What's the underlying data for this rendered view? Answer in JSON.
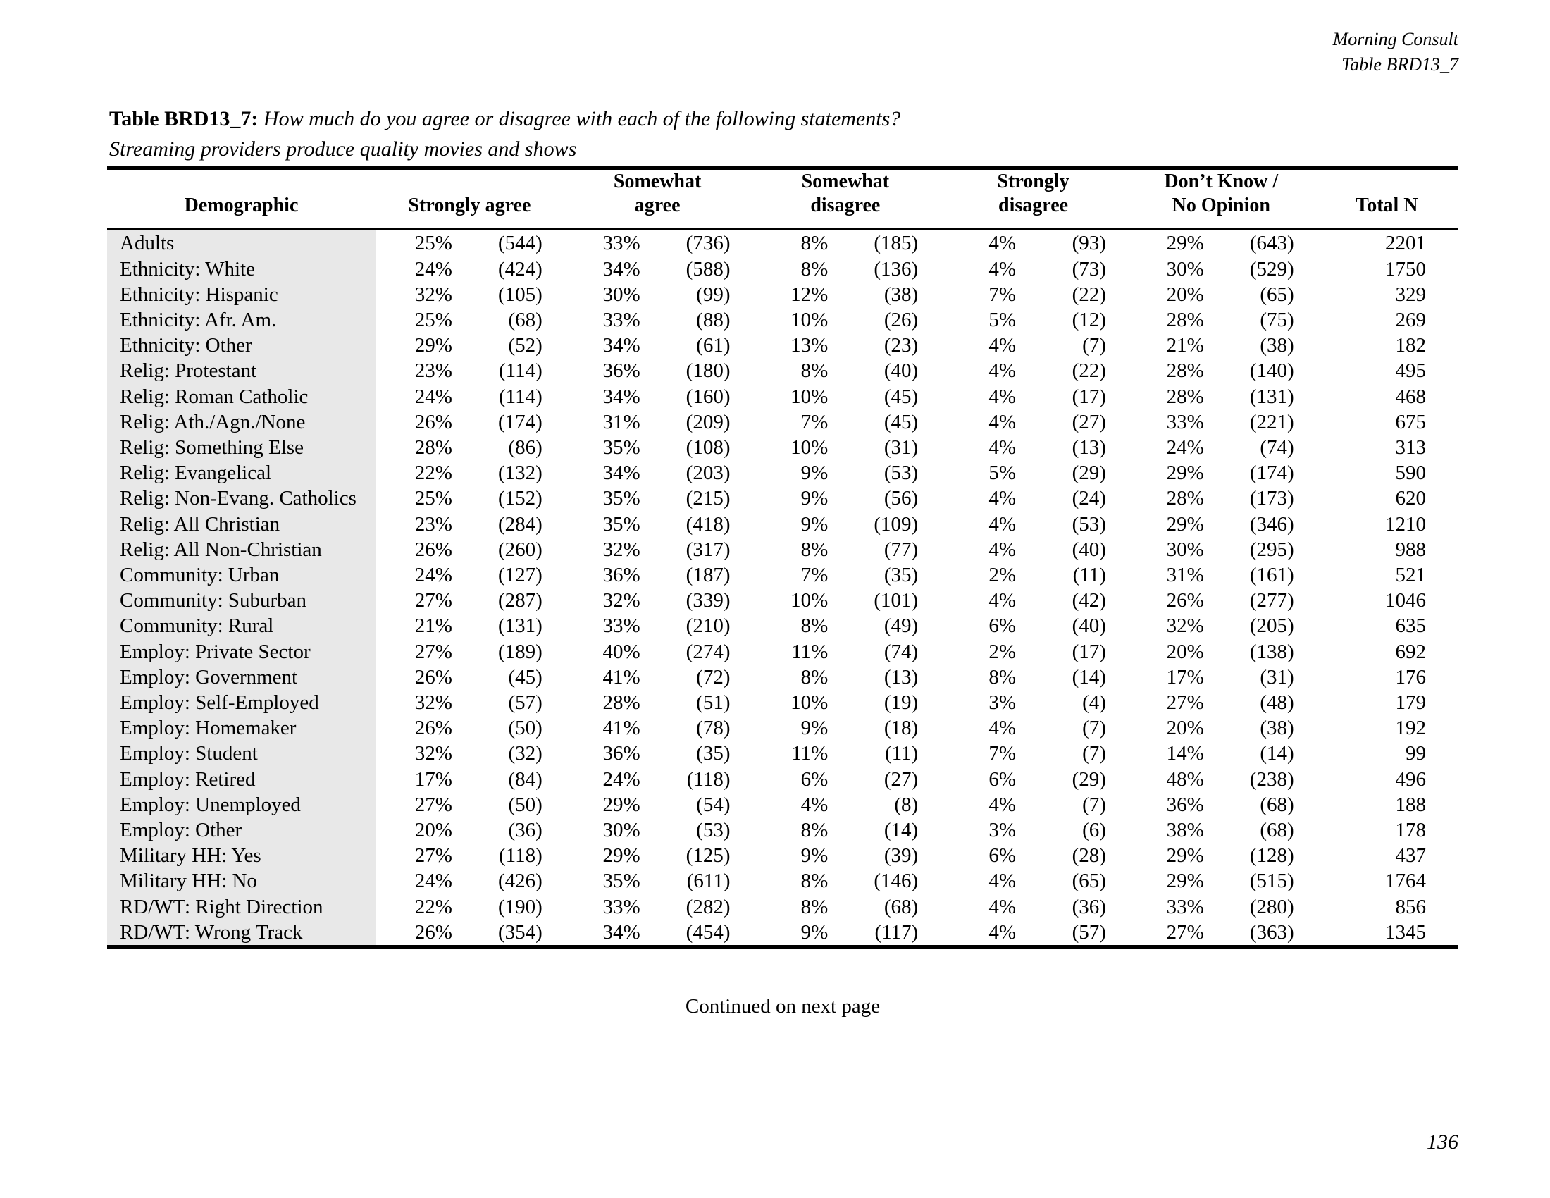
{
  "running_header": {
    "publisher": "Morning Consult",
    "table_ref": "Table BRD13_7"
  },
  "caption": {
    "label": "Table BRD13_7:",
    "question": " How much do you agree or disagree with each of the following statements?",
    "statement": "Streaming providers produce quality movies and shows"
  },
  "footer": {
    "continued": "Continued on next page",
    "page_number": "136"
  },
  "colors": {
    "row_label_shading": "#e8e8e8",
    "rule": "#000000",
    "text": "#000000"
  },
  "table": {
    "headers": {
      "demographic": "Demographic",
      "strongly_agree": "Strongly agree",
      "somewhat_agree_l1": "Somewhat",
      "somewhat_agree_l2": "agree",
      "somewhat_disagree_l1": "Somewhat",
      "somewhat_disagree_l2": "disagree",
      "strongly_disagree_l1": "Strongly",
      "strongly_disagree_l2": "disagree",
      "dk_no_opinion_l1": "Don’t Know /",
      "dk_no_opinion_l2": "No Opinion",
      "total_n": "Total N"
    },
    "rows": [
      {
        "demographic": "Adults",
        "sa_pct": "25%",
        "sa_n": "(544)",
        "swa_pct": "33%",
        "swa_n": "(736)",
        "swd_pct": "8%",
        "swd_n": "(185)",
        "sd_pct": "4%",
        "sd_n": "(93)",
        "dk_pct": "29%",
        "dk_n": "(643)",
        "total": "2201"
      },
      {
        "demographic": "Ethnicity: White",
        "sa_pct": "24%",
        "sa_n": "(424)",
        "swa_pct": "34%",
        "swa_n": "(588)",
        "swd_pct": "8%",
        "swd_n": "(136)",
        "sd_pct": "4%",
        "sd_n": "(73)",
        "dk_pct": "30%",
        "dk_n": "(529)",
        "total": "1750"
      },
      {
        "demographic": "Ethnicity: Hispanic",
        "sa_pct": "32%",
        "sa_n": "(105)",
        "swa_pct": "30%",
        "swa_n": "(99)",
        "swd_pct": "12%",
        "swd_n": "(38)",
        "sd_pct": "7%",
        "sd_n": "(22)",
        "dk_pct": "20%",
        "dk_n": "(65)",
        "total": "329"
      },
      {
        "demographic": "Ethnicity: Afr. Am.",
        "sa_pct": "25%",
        "sa_n": "(68)",
        "swa_pct": "33%",
        "swa_n": "(88)",
        "swd_pct": "10%",
        "swd_n": "(26)",
        "sd_pct": "5%",
        "sd_n": "(12)",
        "dk_pct": "28%",
        "dk_n": "(75)",
        "total": "269"
      },
      {
        "demographic": "Ethnicity: Other",
        "sa_pct": "29%",
        "sa_n": "(52)",
        "swa_pct": "34%",
        "swa_n": "(61)",
        "swd_pct": "13%",
        "swd_n": "(23)",
        "sd_pct": "4%",
        "sd_n": "(7)",
        "dk_pct": "21%",
        "dk_n": "(38)",
        "total": "182"
      },
      {
        "demographic": "Relig: Protestant",
        "sa_pct": "23%",
        "sa_n": "(114)",
        "swa_pct": "36%",
        "swa_n": "(180)",
        "swd_pct": "8%",
        "swd_n": "(40)",
        "sd_pct": "4%",
        "sd_n": "(22)",
        "dk_pct": "28%",
        "dk_n": "(140)",
        "total": "495"
      },
      {
        "demographic": "Relig: Roman Catholic",
        "sa_pct": "24%",
        "sa_n": "(114)",
        "swa_pct": "34%",
        "swa_n": "(160)",
        "swd_pct": "10%",
        "swd_n": "(45)",
        "sd_pct": "4%",
        "sd_n": "(17)",
        "dk_pct": "28%",
        "dk_n": "(131)",
        "total": "468"
      },
      {
        "demographic": "Relig: Ath./Agn./None",
        "sa_pct": "26%",
        "sa_n": "(174)",
        "swa_pct": "31%",
        "swa_n": "(209)",
        "swd_pct": "7%",
        "swd_n": "(45)",
        "sd_pct": "4%",
        "sd_n": "(27)",
        "dk_pct": "33%",
        "dk_n": "(221)",
        "total": "675"
      },
      {
        "demographic": "Relig: Something Else",
        "sa_pct": "28%",
        "sa_n": "(86)",
        "swa_pct": "35%",
        "swa_n": "(108)",
        "swd_pct": "10%",
        "swd_n": "(31)",
        "sd_pct": "4%",
        "sd_n": "(13)",
        "dk_pct": "24%",
        "dk_n": "(74)",
        "total": "313"
      },
      {
        "demographic": "Relig: Evangelical",
        "sa_pct": "22%",
        "sa_n": "(132)",
        "swa_pct": "34%",
        "swa_n": "(203)",
        "swd_pct": "9%",
        "swd_n": "(53)",
        "sd_pct": "5%",
        "sd_n": "(29)",
        "dk_pct": "29%",
        "dk_n": "(174)",
        "total": "590"
      },
      {
        "demographic": "Relig: Non-Evang. Catholics",
        "sa_pct": "25%",
        "sa_n": "(152)",
        "swa_pct": "35%",
        "swa_n": "(215)",
        "swd_pct": "9%",
        "swd_n": "(56)",
        "sd_pct": "4%",
        "sd_n": "(24)",
        "dk_pct": "28%",
        "dk_n": "(173)",
        "total": "620"
      },
      {
        "demographic": "Relig: All Christian",
        "sa_pct": "23%",
        "sa_n": "(284)",
        "swa_pct": "35%",
        "swa_n": "(418)",
        "swd_pct": "9%",
        "swd_n": "(109)",
        "sd_pct": "4%",
        "sd_n": "(53)",
        "dk_pct": "29%",
        "dk_n": "(346)",
        "total": "1210"
      },
      {
        "demographic": "Relig: All Non-Christian",
        "sa_pct": "26%",
        "sa_n": "(260)",
        "swa_pct": "32%",
        "swa_n": "(317)",
        "swd_pct": "8%",
        "swd_n": "(77)",
        "sd_pct": "4%",
        "sd_n": "(40)",
        "dk_pct": "30%",
        "dk_n": "(295)",
        "total": "988"
      },
      {
        "demographic": "Community: Urban",
        "sa_pct": "24%",
        "sa_n": "(127)",
        "swa_pct": "36%",
        "swa_n": "(187)",
        "swd_pct": "7%",
        "swd_n": "(35)",
        "sd_pct": "2%",
        "sd_n": "(11)",
        "dk_pct": "31%",
        "dk_n": "(161)",
        "total": "521"
      },
      {
        "demographic": "Community: Suburban",
        "sa_pct": "27%",
        "sa_n": "(287)",
        "swa_pct": "32%",
        "swa_n": "(339)",
        "swd_pct": "10%",
        "swd_n": "(101)",
        "sd_pct": "4%",
        "sd_n": "(42)",
        "dk_pct": "26%",
        "dk_n": "(277)",
        "total": "1046"
      },
      {
        "demographic": "Community: Rural",
        "sa_pct": "21%",
        "sa_n": "(131)",
        "swa_pct": "33%",
        "swa_n": "(210)",
        "swd_pct": "8%",
        "swd_n": "(49)",
        "sd_pct": "6%",
        "sd_n": "(40)",
        "dk_pct": "32%",
        "dk_n": "(205)",
        "total": "635"
      },
      {
        "demographic": "Employ: Private Sector",
        "sa_pct": "27%",
        "sa_n": "(189)",
        "swa_pct": "40%",
        "swa_n": "(274)",
        "swd_pct": "11%",
        "swd_n": "(74)",
        "sd_pct": "2%",
        "sd_n": "(17)",
        "dk_pct": "20%",
        "dk_n": "(138)",
        "total": "692"
      },
      {
        "demographic": "Employ: Government",
        "sa_pct": "26%",
        "sa_n": "(45)",
        "swa_pct": "41%",
        "swa_n": "(72)",
        "swd_pct": "8%",
        "swd_n": "(13)",
        "sd_pct": "8%",
        "sd_n": "(14)",
        "dk_pct": "17%",
        "dk_n": "(31)",
        "total": "176"
      },
      {
        "demographic": "Employ: Self-Employed",
        "sa_pct": "32%",
        "sa_n": "(57)",
        "swa_pct": "28%",
        "swa_n": "(51)",
        "swd_pct": "10%",
        "swd_n": "(19)",
        "sd_pct": "3%",
        "sd_n": "(4)",
        "dk_pct": "27%",
        "dk_n": "(48)",
        "total": "179"
      },
      {
        "demographic": "Employ: Homemaker",
        "sa_pct": "26%",
        "sa_n": "(50)",
        "swa_pct": "41%",
        "swa_n": "(78)",
        "swd_pct": "9%",
        "swd_n": "(18)",
        "sd_pct": "4%",
        "sd_n": "(7)",
        "dk_pct": "20%",
        "dk_n": "(38)",
        "total": "192"
      },
      {
        "demographic": "Employ: Student",
        "sa_pct": "32%",
        "sa_n": "(32)",
        "swa_pct": "36%",
        "swa_n": "(35)",
        "swd_pct": "11%",
        "swd_n": "(11)",
        "sd_pct": "7%",
        "sd_n": "(7)",
        "dk_pct": "14%",
        "dk_n": "(14)",
        "total": "99"
      },
      {
        "demographic": "Employ: Retired",
        "sa_pct": "17%",
        "sa_n": "(84)",
        "swa_pct": "24%",
        "swa_n": "(118)",
        "swd_pct": "6%",
        "swd_n": "(27)",
        "sd_pct": "6%",
        "sd_n": "(29)",
        "dk_pct": "48%",
        "dk_n": "(238)",
        "total": "496"
      },
      {
        "demographic": "Employ: Unemployed",
        "sa_pct": "27%",
        "sa_n": "(50)",
        "swa_pct": "29%",
        "swa_n": "(54)",
        "swd_pct": "4%",
        "swd_n": "(8)",
        "sd_pct": "4%",
        "sd_n": "(7)",
        "dk_pct": "36%",
        "dk_n": "(68)",
        "total": "188"
      },
      {
        "demographic": "Employ: Other",
        "sa_pct": "20%",
        "sa_n": "(36)",
        "swa_pct": "30%",
        "swa_n": "(53)",
        "swd_pct": "8%",
        "swd_n": "(14)",
        "sd_pct": "3%",
        "sd_n": "(6)",
        "dk_pct": "38%",
        "dk_n": "(68)",
        "total": "178"
      },
      {
        "demographic": "Military HH: Yes",
        "sa_pct": "27%",
        "sa_n": "(118)",
        "swa_pct": "29%",
        "swa_n": "(125)",
        "swd_pct": "9%",
        "swd_n": "(39)",
        "sd_pct": "6%",
        "sd_n": "(28)",
        "dk_pct": "29%",
        "dk_n": "(128)",
        "total": "437"
      },
      {
        "demographic": "Military HH: No",
        "sa_pct": "24%",
        "sa_n": "(426)",
        "swa_pct": "35%",
        "swa_n": "(611)",
        "swd_pct": "8%",
        "swd_n": "(146)",
        "sd_pct": "4%",
        "sd_n": "(65)",
        "dk_pct": "29%",
        "dk_n": "(515)",
        "total": "1764"
      },
      {
        "demographic": "RD/WT: Right Direction",
        "sa_pct": "22%",
        "sa_n": "(190)",
        "swa_pct": "33%",
        "swa_n": "(282)",
        "swd_pct": "8%",
        "swd_n": "(68)",
        "sd_pct": "4%",
        "sd_n": "(36)",
        "dk_pct": "33%",
        "dk_n": "(280)",
        "total": "856"
      },
      {
        "demographic": "RD/WT: Wrong Track",
        "sa_pct": "26%",
        "sa_n": "(354)",
        "swa_pct": "34%",
        "swa_n": "(454)",
        "swd_pct": "9%",
        "swd_n": "(117)",
        "sd_pct": "4%",
        "sd_n": "(57)",
        "dk_pct": "27%",
        "dk_n": "(363)",
        "total": "1345"
      }
    ]
  }
}
